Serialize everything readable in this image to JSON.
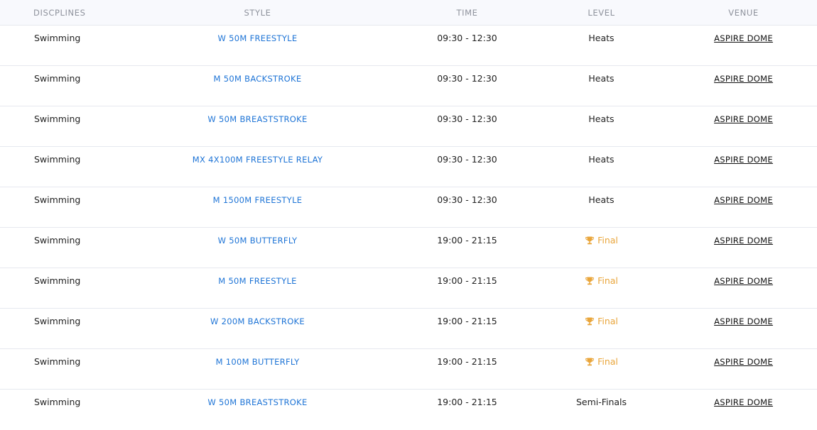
{
  "table": {
    "headers": {
      "discipline": "DISCPLINES",
      "style": "STYLE",
      "time": "TIME",
      "level": "LEVEL",
      "venue": "VENUE"
    },
    "rows": [
      {
        "discipline": "Swimming",
        "style": "W 50M FREESTYLE",
        "time": "09:30 - 12:30",
        "level": "Heats",
        "final": false,
        "venue": "ASPIRE DOME"
      },
      {
        "discipline": "Swimming",
        "style": "M 50M BACKSTROKE",
        "time": "09:30 - 12:30",
        "level": "Heats",
        "final": false,
        "venue": "ASPIRE DOME"
      },
      {
        "discipline": "Swimming",
        "style": "W 50M BREASTSTROKE",
        "time": "09:30 - 12:30",
        "level": "Heats",
        "final": false,
        "venue": "ASPIRE DOME"
      },
      {
        "discipline": "Swimming",
        "style": "MX 4X100M FREESTYLE RELAY",
        "time": "09:30 - 12:30",
        "level": "Heats",
        "final": false,
        "venue": "ASPIRE DOME"
      },
      {
        "discipline": "Swimming",
        "style": "M 1500M FREESTYLE",
        "time": "09:30 - 12:30",
        "level": "Heats",
        "final": false,
        "venue": "ASPIRE DOME"
      },
      {
        "discipline": "Swimming",
        "style": "W 50M BUTTERFLY",
        "time": "19:00 - 21:15",
        "level": "Final",
        "final": true,
        "venue": "ASPIRE DOME"
      },
      {
        "discipline": "Swimming",
        "style": "M 50M FREESTYLE",
        "time": "19:00 - 21:15",
        "level": "Final",
        "final": true,
        "venue": "ASPIRE DOME"
      },
      {
        "discipline": "Swimming",
        "style": "W 200M BACKSTROKE",
        "time": "19:00 - 21:15",
        "level": "Final",
        "final": true,
        "venue": "ASPIRE DOME"
      },
      {
        "discipline": "Swimming",
        "style": "M 100M BUTTERFLY",
        "time": "19:00 - 21:15",
        "level": "Final",
        "final": true,
        "venue": "ASPIRE DOME"
      },
      {
        "discipline": "Swimming",
        "style": "W 50M BREASTSTROKE",
        "time": "19:00 - 21:15",
        "level": "Semi-Finals",
        "final": false,
        "venue": "ASPIRE DOME"
      }
    ]
  },
  "icons": {
    "final_level": "trophy-icon"
  },
  "colors": {
    "style_link": "#1e74d6",
    "final_level": "#e9a53a",
    "header_text": "#8e929c",
    "header_bg": "#f8f9fd"
  }
}
